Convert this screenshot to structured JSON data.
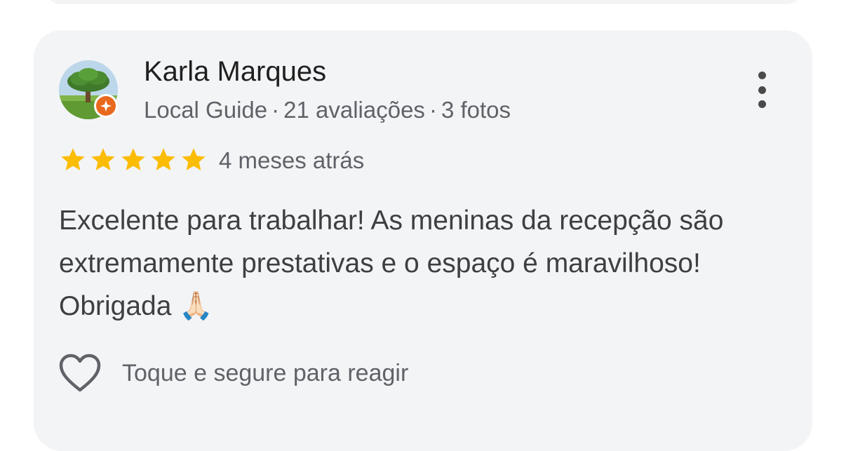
{
  "review": {
    "author": {
      "name": "Karla Marques",
      "level": "Local Guide",
      "reviews_count": "21 avaliações",
      "photos_count": "3 fotos",
      "separator": "·",
      "avatar_icon": "tree-landscape-avatar",
      "badge_icon": "local-guide-badge-icon"
    },
    "rating": {
      "value": 5,
      "max": 5,
      "color": "#fbbc04"
    },
    "time_ago": "4 meses atrás",
    "text": "Excelente para trabalhar! As meninas da recepção são extremamente prestativas e o espaço é maravilhoso! Obrigada",
    "emoji": "🙏🏻",
    "react": {
      "label": "Toque e segure para reagir",
      "icon": "heart-outline-icon"
    },
    "menu_icon": "more-vert-icon"
  },
  "colors": {
    "card_background": "#f3f4f6",
    "badge_orange": "#e8691e",
    "text_primary": "#1f1f1f",
    "text_secondary": "#5f6368"
  }
}
